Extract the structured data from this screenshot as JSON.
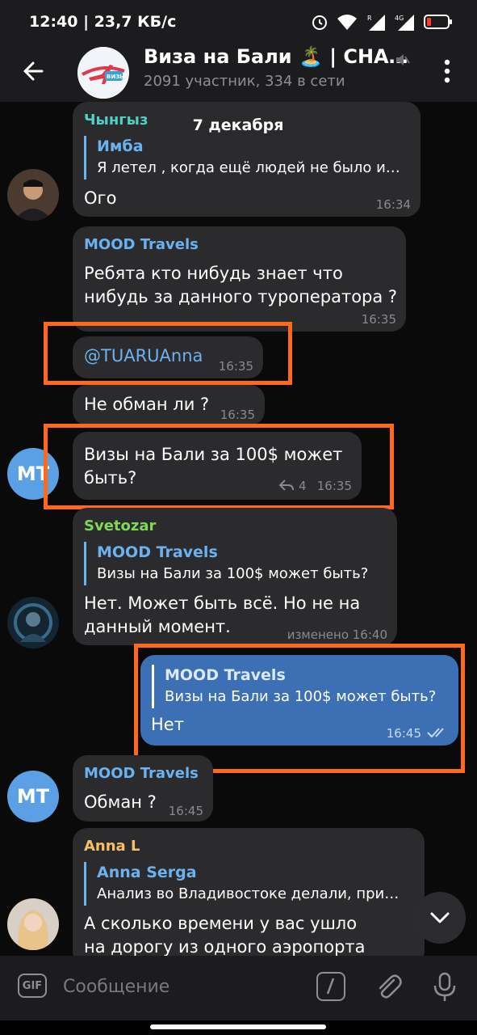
{
  "status_bar": {
    "time": "12:40",
    "speed": "23,7 КБ/с",
    "icons": [
      "alarm-icon",
      "wifi-icon",
      "signal-r-icon",
      "signal-4g-icon",
      "battery-icon"
    ]
  },
  "header": {
    "title": "Виза на Бали 🏝️ | CHA…",
    "subtitle": "2091 участник, 334 в сети",
    "avatar_text": "ВИЗЫ"
  },
  "date_divider": "7 декабря",
  "messages": [
    {
      "sender": "Чынгыз",
      "sender_color": "#4fd1c5",
      "quote_name": "Имба",
      "quote_text": "Я летел , когда ещё людей не было и…",
      "text": "Ого",
      "time": "16:34"
    },
    {
      "sender": "MOOD Travels",
      "sender_color": "#6cb2f0",
      "text_line1": "Ребята кто нибудь знает что",
      "text_line2": "нибудь за данного туроператора ?",
      "time": "16:35"
    },
    {
      "text": "@TUARUAnna",
      "time": "16:35"
    },
    {
      "text": "Не обман ли ?",
      "time": "16:35"
    },
    {
      "avatar": "MT",
      "text_line1": "Визы на Бали за 100$ может",
      "text_line2": "быть?",
      "replies": "4",
      "time": "16:35"
    },
    {
      "sender": "Svetozar",
      "sender_color": "#7ed957",
      "quote_name": "MOOD Travels",
      "quote_text": "Визы на Бали за 100$ может быть?",
      "text_line1": "Нет. Может быть всё. Но не на",
      "text_line2": "данный момент.",
      "time": "изменено 16:40"
    },
    {
      "quote_name": "MOOD Travels",
      "quote_text": "Визы на Бали за 100$ может быть?",
      "text": "Нет",
      "time": "16:45"
    },
    {
      "avatar": "MT",
      "sender": "MOOD Travels",
      "sender_color": "#6cb2f0",
      "text": "Обман ?",
      "time": "16:45"
    },
    {
      "sender": "Anna L",
      "sender_color": "#f6c063",
      "quote_name": "Anna Serga",
      "quote_text": "Анализ во Владивостоке делали, при…",
      "text_line1": "А сколько времени у вас ушло",
      "text_line2": "на дорогу из одного аэропорта"
    }
  ],
  "input": {
    "placeholder": "Сообщение",
    "gif_label": "GIF"
  },
  "colors": {
    "accent": "#6cb2f0",
    "outgoing_bubble": "#3c6fb4",
    "incoming_bubble": "#2b2b2d",
    "highlight": "#ff6a1a"
  }
}
